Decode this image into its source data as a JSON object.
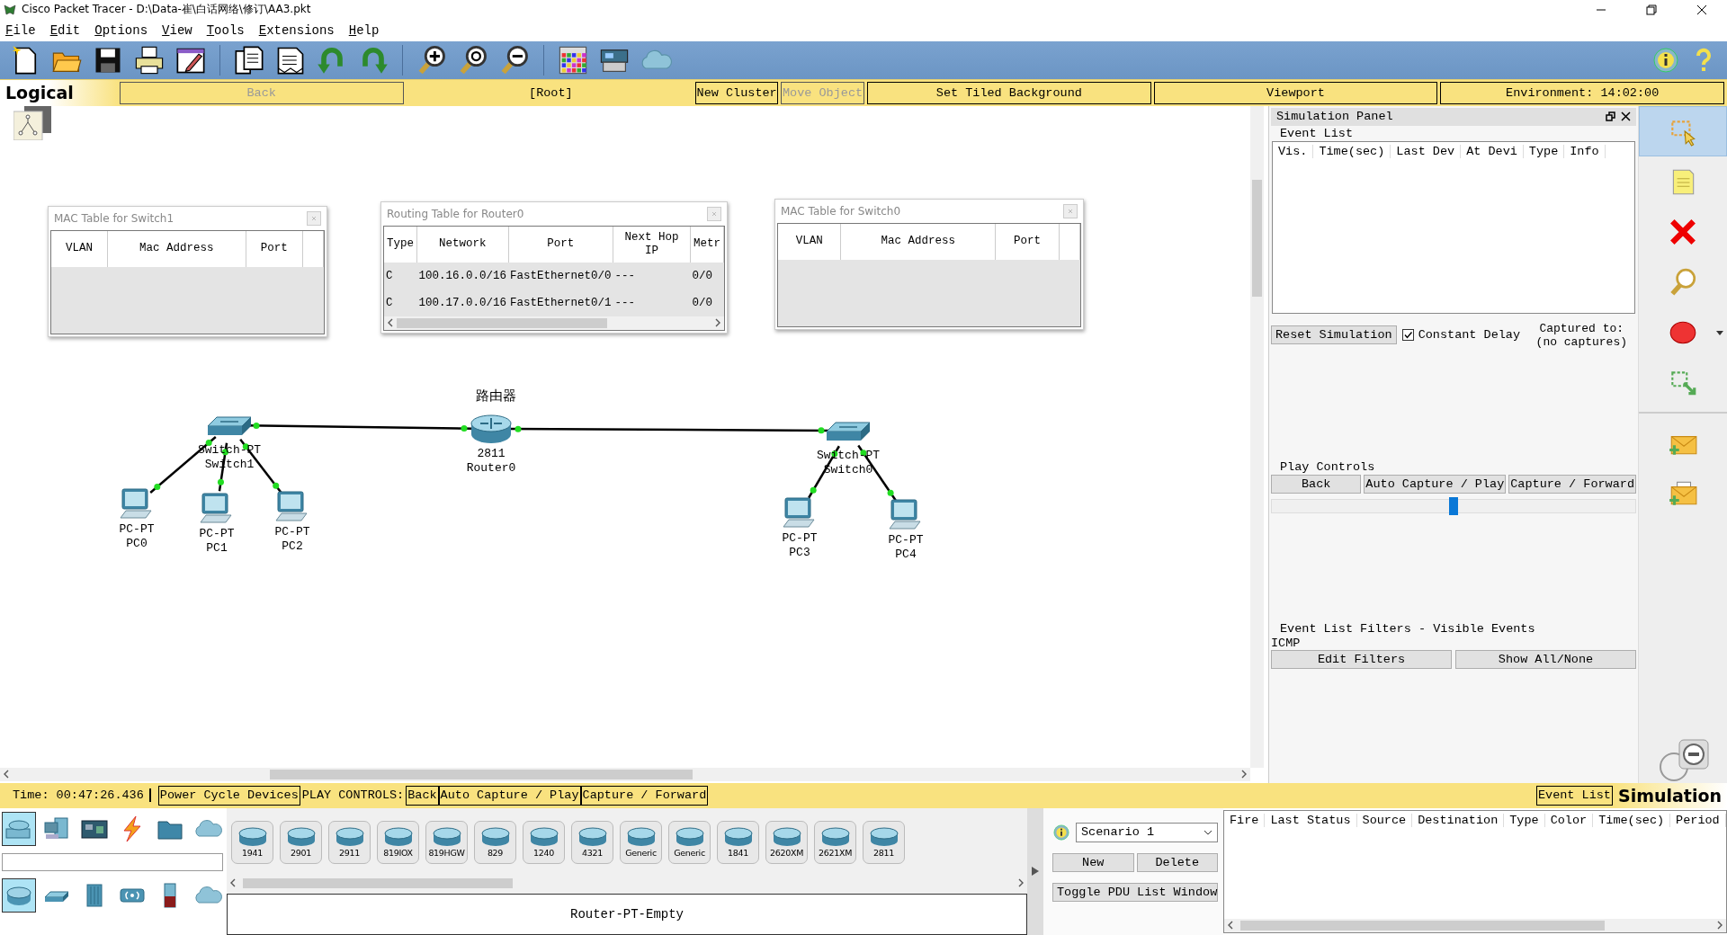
{
  "window": {
    "title": "Cisco Packet Tracer - D:\\Data-崔\\白话网络\\修订\\AA3.pkt"
  },
  "menu": [
    "File",
    "Edit",
    "Options",
    "View",
    "Tools",
    "Extensions",
    "Help"
  ],
  "nav": {
    "mode": "Logical",
    "buttons": [
      {
        "label": "Back",
        "kind": "button",
        "disabled": true
      },
      {
        "label": "[Root]",
        "kind": "path",
        "disabled": false
      },
      {
        "label": "New Cluster",
        "kind": "button",
        "disabled": false
      },
      {
        "label": "Move Object",
        "kind": "button",
        "disabled": true
      },
      {
        "label": "Set Tiled Background",
        "kind": "button",
        "disabled": false
      },
      {
        "label": "Viewport",
        "kind": "button",
        "disabled": false
      },
      {
        "label": "Environment: 14:02:00",
        "kind": "button",
        "disabled": false
      }
    ]
  },
  "canvas": {
    "tables": [
      {
        "title": "MAC Table for Switch1",
        "columns": [
          "VLAN",
          "Mac Address",
          "Port"
        ]
      },
      {
        "title": "Routing Table for Router0",
        "columns": [
          "Type",
          "Network",
          "Port",
          "Next Hop IP",
          "Metr"
        ],
        "rows": [
          [
            "C",
            "100.16.0.0/16",
            "FastEthernet0/0",
            "---",
            "0/0"
          ],
          [
            "C",
            "100.17.0.0/16",
            "FastEthernet0/1",
            "---",
            "0/0"
          ]
        ]
      },
      {
        "title": "MAC Table for Switch0",
        "columns": [
          "VLAN",
          "Mac Address",
          "Port"
        ]
      }
    ],
    "note": "路由器",
    "devices": [
      {
        "kind": "switch",
        "model": "Switch-PT",
        "name": "Switch1"
      },
      {
        "kind": "router",
        "model": "2811",
        "name": "Router0"
      },
      {
        "kind": "switch",
        "model": "Switch-PT",
        "name": "Switch0"
      },
      {
        "kind": "pc",
        "model": "PC-PT",
        "name": "PC0"
      },
      {
        "kind": "pc",
        "model": "PC-PT",
        "name": "PC1"
      },
      {
        "kind": "pc",
        "model": "PC-PT",
        "name": "PC2"
      },
      {
        "kind": "pc",
        "model": "PC-PT",
        "name": "PC3"
      },
      {
        "kind": "pc",
        "model": "PC-PT",
        "name": "PC4"
      }
    ],
    "links": [
      {
        "up": true
      },
      {
        "up": true
      },
      {
        "up": true
      },
      {
        "up": true
      },
      {
        "up": true
      },
      {
        "up": true
      },
      {
        "up": true
      }
    ]
  },
  "simulation_panel": {
    "title": "Simulation Panel",
    "event_list": {
      "title": "Event List",
      "columns": [
        "Vis.",
        "Time(sec)",
        "Last Dev",
        "At Devi",
        "Type",
        "Info"
      ]
    },
    "reset_button": "Reset Simulation",
    "constant_delay": {
      "label": "Constant Delay",
      "checked": true
    },
    "captured_to": [
      "Captured to:",
      "(no captures)"
    ],
    "play_controls": {
      "title": "Play Controls",
      "buttons": [
        "Back",
        "Auto Capture / Play",
        "Capture / Forward"
      ],
      "level": 0.5
    },
    "filters": {
      "title": "Event List Filters - Visible Events",
      "events": "ICMP",
      "buttons": [
        "Edit Filters",
        "Show All/None"
      ]
    }
  },
  "status_bar": {
    "items": [
      {
        "kind": "text",
        "label": "Time: 00:47:26.436"
      },
      {
        "kind": "button",
        "label": "Power Cycle Devices"
      },
      {
        "kind": "text",
        "label": "PLAY CONTROLS:"
      },
      {
        "kind": "button",
        "label": "Back"
      },
      {
        "kind": "button",
        "label": "Auto Capture / Play"
      },
      {
        "kind": "button",
        "label": "Capture / Forward"
      }
    ],
    "event_list_button": "Event List",
    "mode": "Simulation"
  },
  "device_panel": {
    "categories": [
      {
        "selected": true
      },
      {
        "selected": false
      },
      {
        "selected": false
      },
      {
        "selected": false
      },
      {
        "selected": false
      },
      {
        "selected": false
      }
    ],
    "subtypes": [
      {
        "selected": true
      },
      {
        "selected": false
      },
      {
        "selected": false
      },
      {
        "selected": false
      },
      {
        "selected": false
      },
      {
        "selected": false
      }
    ],
    "models": [
      "1941",
      "2901",
      "2911",
      "819IOX",
      "819HGW",
      "829",
      "1240",
      "4321",
      "Generic",
      "Generic",
      "1841",
      "2620XM",
      "2621XM",
      "2811"
    ],
    "description": "Router-PT-Empty"
  },
  "scenario": {
    "value": "Scenario 1",
    "buttons": [
      "New",
      "Delete"
    ],
    "toggle_button": "Toggle PDU List Window"
  },
  "pdu_table": {
    "columns": [
      "Fire",
      "Last Status",
      "Source",
      "Destination",
      "Type",
      "Color",
      "Time(sec)",
      "Period"
    ]
  }
}
